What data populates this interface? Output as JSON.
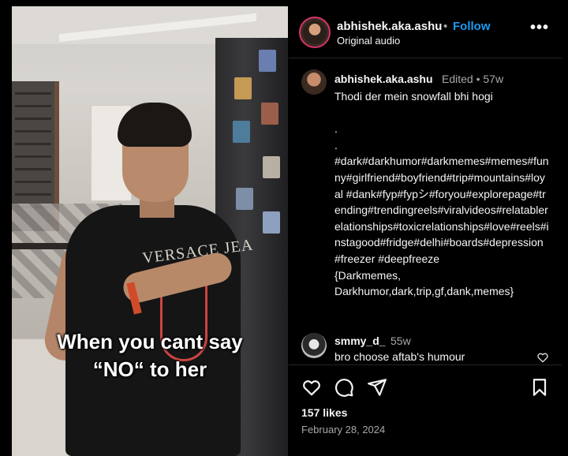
{
  "video": {
    "shirt_text": "VERSACE JEA",
    "caption_line1": "When you cant say",
    "caption_line2": "“NO“ to her"
  },
  "header": {
    "username": "abhishek.aka.ashu",
    "separator": "•",
    "follow_label": "Follow",
    "audio": "Original audio",
    "more_label": "•••"
  },
  "post": {
    "username": "abhishek.aka.ashu",
    "edited": "Edited •  57w",
    "text": "Thodi der mein snowfall bhi hogi\n\n.\n.\n#dark#darkhumor#darkmemes#memes#funny#girlfriend#boyfriend#trip#mountains#loyal #dank#fyp#fypシ#foryou#explorepage#trending#trendingreels#viralvideos#relatablerelationships#toxicrelationships#love#reels#instagood#fridge#delhi#boards#depression#freezer #deepfreeze\n{Darkmemes,\nDarkhumor,dark,trip,gf,dank,memes}"
  },
  "comment": {
    "username": "smmy_d_",
    "time": "55w",
    "text": "bro choose aftab's humour"
  },
  "actions": {
    "icons": [
      "heart-icon",
      "comment-icon",
      "share-icon",
      "bookmark-icon"
    ]
  },
  "stats": {
    "likes": "157 likes",
    "date": "February 28, 2024"
  },
  "colors": {
    "accent": "#1d9bf0",
    "background": "#000000",
    "muted": "#a8a8a8"
  }
}
